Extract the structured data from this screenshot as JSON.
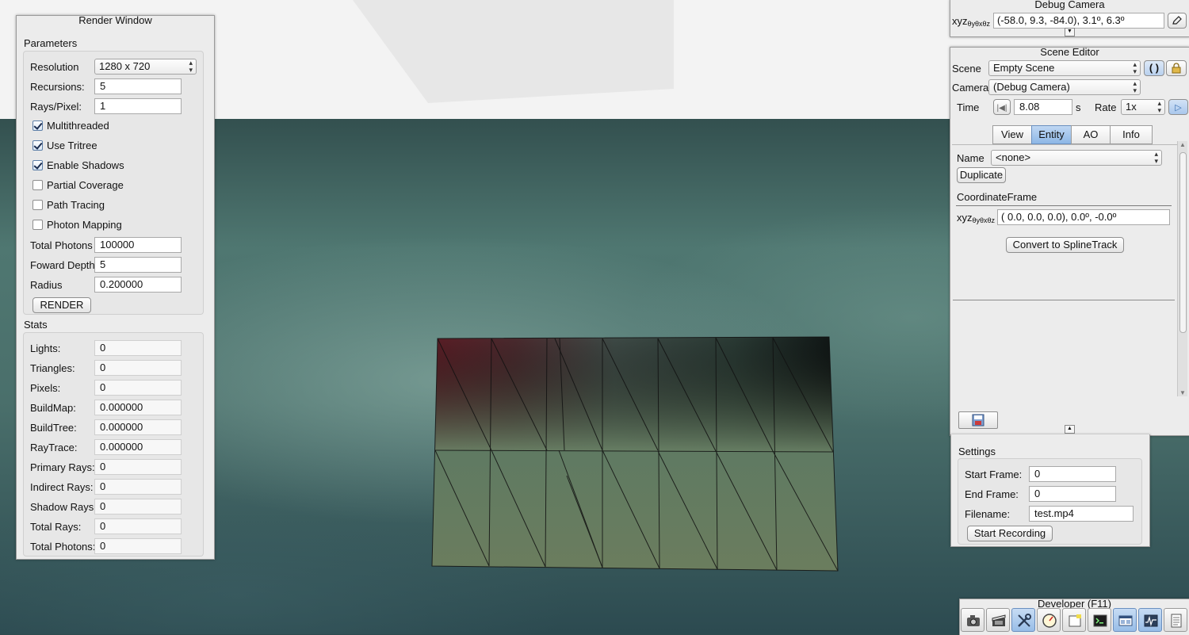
{
  "render_window": {
    "title": "Render Window",
    "parameters_label": "Parameters",
    "resolution_label": "Resolution",
    "resolution_value": "1280 x 720",
    "recursions_label": "Recursions:",
    "recursions_value": "5",
    "rays_per_pixel_label": "Rays/Pixel:",
    "rays_per_pixel_value": "1",
    "checkboxes": [
      {
        "label": "Multithreaded",
        "checked": true
      },
      {
        "label": "Use Tritree",
        "checked": true
      },
      {
        "label": "Enable Shadows",
        "checked": true
      },
      {
        "label": "Partial Coverage",
        "checked": false
      },
      {
        "label": "Path Tracing",
        "checked": false
      },
      {
        "label": "Photon Mapping",
        "checked": false
      }
    ],
    "total_photons_label": "Total Photons",
    "total_photons_value": "100000",
    "forward_depth_label": "Foward Depth",
    "forward_depth_value": "5",
    "radius_label": "Radius",
    "radius_value": "0.200000",
    "render_button": "RENDER",
    "stats_label": "Stats",
    "stats": [
      {
        "label": "Lights:",
        "value": "0"
      },
      {
        "label": "Triangles:",
        "value": "0"
      },
      {
        "label": "Pixels:",
        "value": "0"
      },
      {
        "label": "BuildMap:",
        "value": "0.000000"
      },
      {
        "label": "BuildTree:",
        "value": "0.000000"
      },
      {
        "label": "RayTrace:",
        "value": "0.000000"
      },
      {
        "label": "Primary Rays:",
        "value": "0"
      },
      {
        "label": "Indirect Rays:",
        "value": "0"
      },
      {
        "label": "Shadow Rays:",
        "value": "0"
      },
      {
        "label": "Total Rays:",
        "value": "0"
      },
      {
        "label": "Total Photons:",
        "value": "0"
      }
    ]
  },
  "debug_camera": {
    "title": "Debug Camera",
    "coord_prefix": "xyz",
    "coord_sub": "θyθxθz",
    "coord_value": "(-58.0,   9.3, -84.0),   3.1º,   6.3º"
  },
  "scene_editor": {
    "title": "Scene Editor",
    "scene_label": "Scene",
    "scene_value": "Empty Scene",
    "camera_label": "Camera",
    "camera_value": "(Debug Camera)",
    "time_label": "Time",
    "time_value": "8.08",
    "time_unit": "s",
    "rate_label": "Rate",
    "rate_value": "1x",
    "tabs": [
      "View",
      "Entity",
      "AO",
      "Info"
    ],
    "active_tab": "Entity",
    "name_label": "Name",
    "name_value": "<none>",
    "duplicate_button": "Duplicate",
    "coordinate_frame_label": "CoordinateFrame",
    "frame_prefix": "xyz",
    "frame_sub": "θyθxθz",
    "frame_value": "(  0.0,   0.0,   0.0),   0.0º,  -0.0º",
    "convert_button": "Convert to SplineTrack"
  },
  "video_settings": {
    "settings_label": "Settings",
    "start_frame_label": "Start Frame:",
    "start_frame_value": "0",
    "end_frame_label": "End Frame:",
    "end_frame_value": "0",
    "filename_label": "Filename:",
    "filename_value": "test.mp4",
    "start_recording_button": "Start Recording"
  },
  "developer": {
    "title": "Developer (F11)",
    "tools": [
      "camera-icon",
      "film-icon",
      "wrench-icon",
      "speedometer-icon",
      "note-icon",
      "terminal-icon",
      "window-icon",
      "profiler-icon",
      "document-icon"
    ],
    "active_tool": "wrench-icon"
  }
}
